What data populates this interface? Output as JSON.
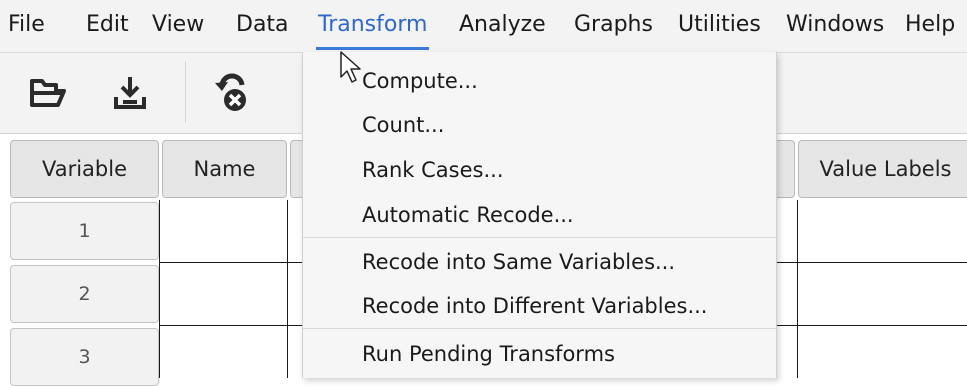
{
  "menubar": {
    "items": [
      {
        "label": "File"
      },
      {
        "label": "Edit"
      },
      {
        "label": "View"
      },
      {
        "label": "Data"
      },
      {
        "label": "Transform"
      },
      {
        "label": "Analyze"
      },
      {
        "label": "Graphs"
      },
      {
        "label": "Utilities"
      },
      {
        "label": "Windows"
      },
      {
        "label": "Help"
      }
    ],
    "active": "Transform"
  },
  "toolbar": {
    "buttons": [
      {
        "icon": "open-file-icon"
      },
      {
        "icon": "save-icon"
      },
      {
        "icon": "undo-delete-icon"
      }
    ]
  },
  "grid": {
    "columns": [
      "Variable",
      "Name",
      "Value Labels"
    ],
    "rows": [
      "1",
      "2",
      "3"
    ]
  },
  "transform_menu": {
    "items": [
      {
        "label": "Compute..."
      },
      {
        "label": "Count..."
      },
      {
        "label": "Rank Cases..."
      },
      {
        "label": "Automatic Recode..."
      },
      {
        "label": "Recode into Same Variables..."
      },
      {
        "label": "Recode into Different Variables..."
      },
      {
        "label": "Run Pending Transforms"
      }
    ]
  },
  "colors": {
    "accent": "#3b7bd8",
    "menubar_bg": "#f3f3f3",
    "header_bg": "#e6e6e6"
  }
}
